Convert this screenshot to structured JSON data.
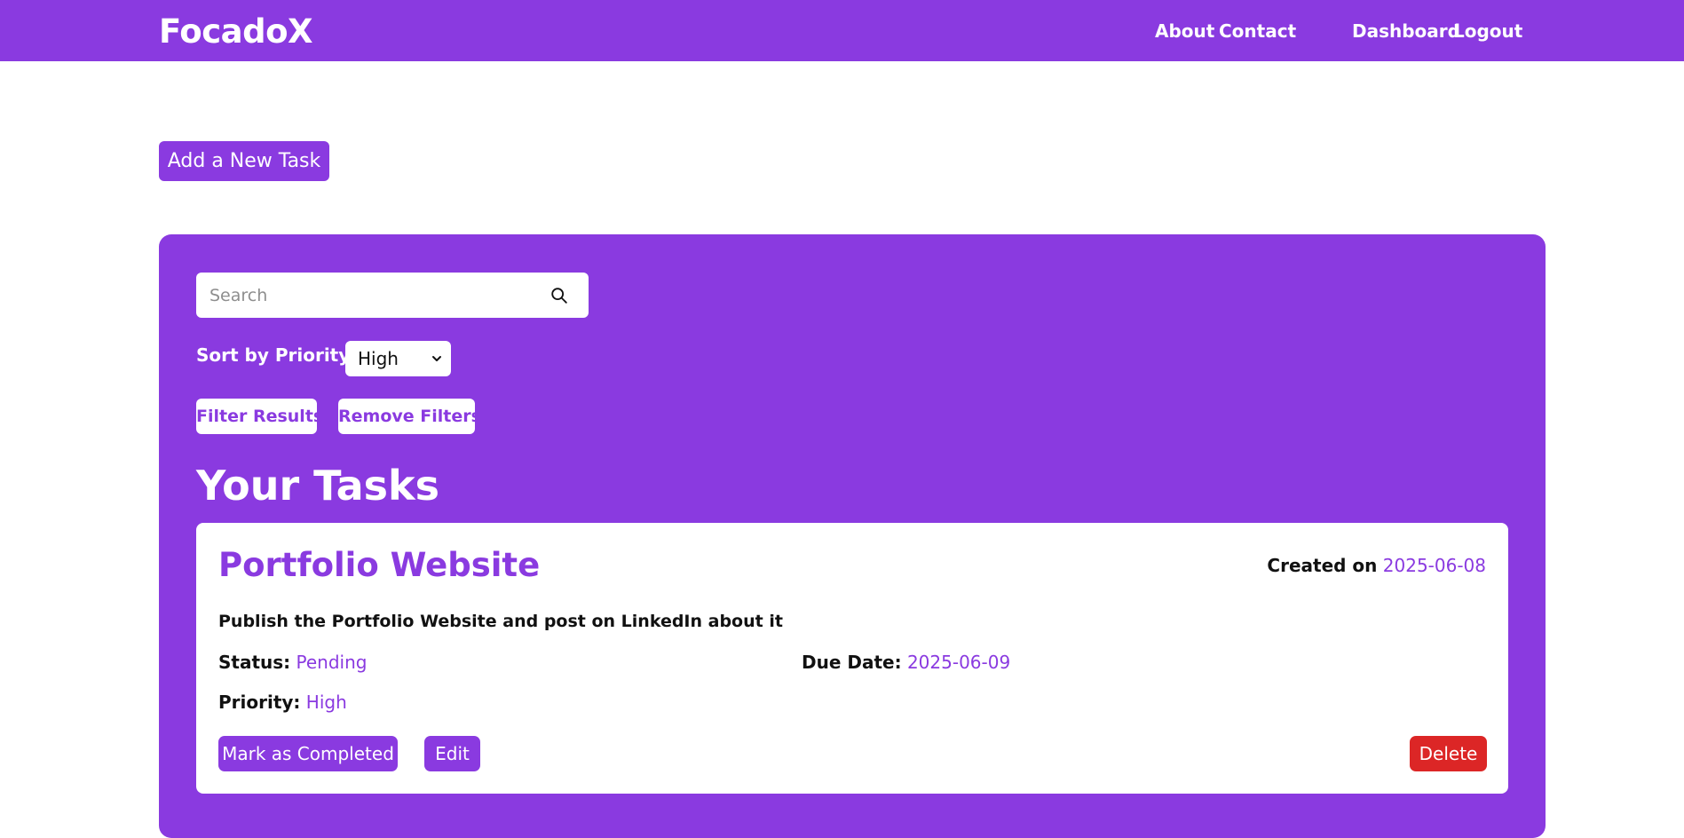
{
  "nav": {
    "brand": "FocadoX",
    "links": [
      "About",
      "Contact",
      "Dashboard",
      "Logout"
    ]
  },
  "add_task_label": "Add a New Task",
  "filters": {
    "search_placeholder": "Search",
    "sort_label": "Sort by Priority:",
    "sort_selected": "High",
    "filter_label": "Filter Results",
    "remove_label": "Remove Filters"
  },
  "tasks_heading": "Your Tasks",
  "tasks": [
    {
      "title": "Portfolio Website",
      "created_label": "Created on",
      "created_date": "2025-06-08",
      "description": "Publish the Portfolio Website and post on LinkedIn about it",
      "status_label": "Status:",
      "status": "Pending",
      "due_label": "Due Date:",
      "due_date": "2025-06-09",
      "priority_label": "Priority:",
      "priority": "High",
      "complete_label": "Mark as Completed",
      "edit_label": "Edit",
      "delete_label": "Delete"
    }
  ],
  "colors": {
    "brand": "#8a3ae0",
    "danger": "#dc2626",
    "surface": "#ffffff"
  },
  "icons": {
    "search": "search-icon",
    "select": "chevron-down-icon"
  }
}
